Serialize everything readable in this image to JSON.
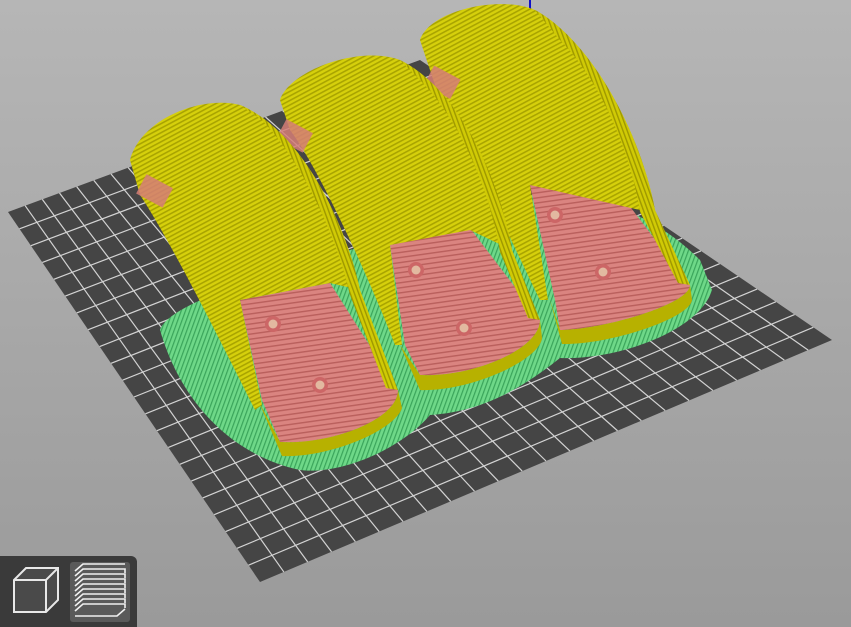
{
  "viewport": {
    "view_mode": "preview",
    "bed_color": "#444444",
    "grid_color": "#cfcfcf",
    "axis_z_color": "#1010c8",
    "feature_colors": {
      "perimeter": "#d7d20f",
      "external_perimeter": "#c8c200",
      "solid_infill": "#d67a78",
      "skirt_brim": "#5fd37c"
    },
    "objects": [
      {
        "name_visible": false
      },
      {
        "name_visible": false
      },
      {
        "name_visible": false
      }
    ]
  },
  "toolbar": {
    "buttons": [
      {
        "icon": "3d-view-cube-icon",
        "active": false
      },
      {
        "icon": "layers-preview-icon",
        "active": true
      }
    ]
  }
}
